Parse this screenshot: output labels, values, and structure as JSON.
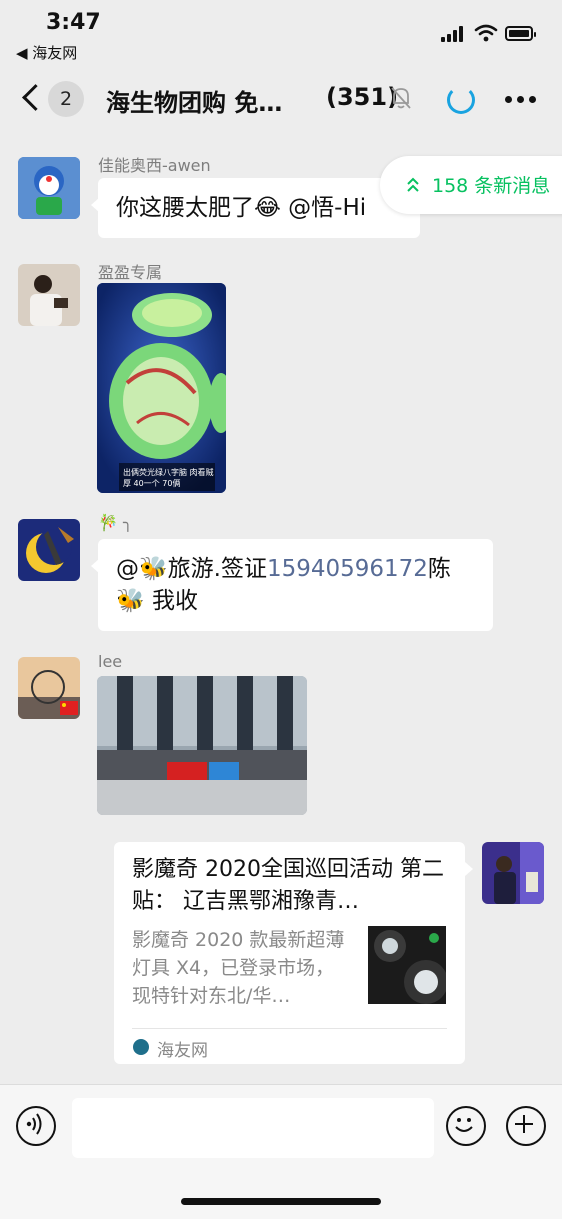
{
  "status_bar": {
    "time": "3:47",
    "back_app": "◀ 海友网"
  },
  "nav": {
    "unread_badge": "2",
    "title": "海生物团购 免…",
    "member_count": "(351)"
  },
  "new_messages": {
    "label": "158 条新消息"
  },
  "messages": [
    {
      "sender": "佳能奥西-awen",
      "text_pre": "你这腰太肥了",
      "emoji": "😂",
      "text_post": " @悟-Hi"
    },
    {
      "sender": "盈盈专属",
      "image_caption": "出俩荧光绿八字脑 肉看贼厚 40一个 70俩"
    },
    {
      "sender": "🎋 ╮",
      "text_pre": "@🐝旅游.签证",
      "phone": "15940596172",
      "text_mid": "陈",
      "text_line2": "🐝 我收"
    },
    {
      "sender": "lee"
    }
  ],
  "link_card": {
    "title": "影魔奇 2020全国巡回活动 第二贴： 辽吉黑鄂湘豫青…",
    "description": "影魔奇 2020 款最新超薄灯具 X4，已登录市场，现特针对东北/华…",
    "source": "海友网"
  },
  "colors": {
    "accent_green": "#07c160",
    "link_blue": "#576b95",
    "bg": "#ededed"
  }
}
